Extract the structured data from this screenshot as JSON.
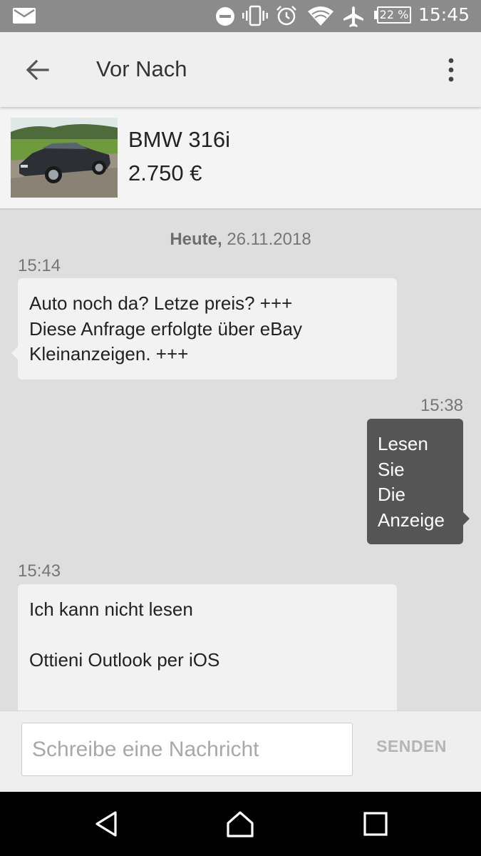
{
  "status_bar": {
    "time": "15:45",
    "battery": "22 %",
    "icons": [
      "mail-icon",
      "do-not-disturb-icon",
      "vibrate-icon",
      "alarm-icon",
      "wifi-icon",
      "airplane-icon",
      "battery-icon"
    ]
  },
  "app_bar": {
    "title": "Vor Nach",
    "back_icon": "arrow-back-icon",
    "menu_icon": "more-vert-icon"
  },
  "ad": {
    "title": "BMW 316i",
    "price": "2.750 €"
  },
  "conversation": {
    "date_day": "Heute,",
    "date_value": " 26.11.2018",
    "messages": [
      {
        "direction": "incoming",
        "time": "15:14",
        "text": "Auto noch da? Letze preis?  +++\nDiese Anfrage erfolgte über eBay\nKleinanzeigen. +++"
      },
      {
        "direction": "outgoing",
        "time": "15:38",
        "text": "Lesen\nSie\nDie\nAnzeige"
      },
      {
        "direction": "incoming",
        "time": "15:43",
        "text": "Ich kann nicht lesen\n\nOttieni Outlook per iOS"
      }
    ]
  },
  "compose": {
    "placeholder": "Schreibe eine Nachricht",
    "value": "",
    "send_label": "SENDEN"
  },
  "nav_bar": {
    "icons": [
      "nav-back-icon",
      "nav-home-icon",
      "nav-recents-icon"
    ]
  },
  "colors": {
    "status_bar": "#8b8b8b",
    "app_bar": "#efefef",
    "chat_background": "#dedede",
    "incoming_bubble": "#f2f2f2",
    "outgoing_bubble": "#555555",
    "send_disabled": "#b5b5b5"
  }
}
